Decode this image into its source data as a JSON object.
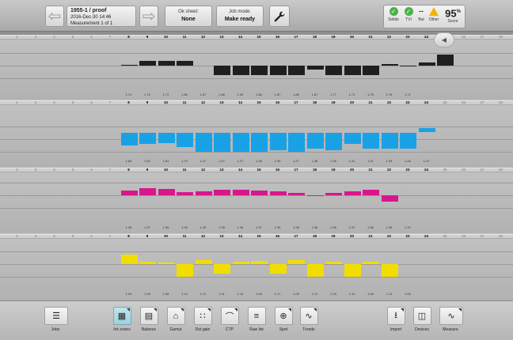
{
  "header": {
    "job_title": "1955-1 / proof",
    "job_date": "2016-Dec-30 14:46",
    "job_measurement": "Measurement 1 of 1",
    "ok_sheet_label": "Ok sheet:",
    "ok_sheet_value": "None",
    "job_mode_label": "Job mode:",
    "job_mode_value": "Make ready",
    "back_icon": "arrow-left-icon",
    "forward_icon": "arrow-right-icon",
    "settings_icon": "wrench-icon"
  },
  "status": {
    "solids_label": "Solids",
    "tvi_label": "TVI",
    "bal_label": "Bal",
    "bal_value": "--",
    "other_label": "Other",
    "score_label": "Score",
    "score_value": "95",
    "score_unit": "%",
    "colors": {
      "ok": "#4ab04a",
      "warning": "#f2b300"
    }
  },
  "zones": {
    "all": [
      "1",
      "2",
      "3",
      "4",
      "5",
      "6",
      "7",
      "8",
      "9",
      "10",
      "11",
      "12",
      "13",
      "14",
      "15",
      "16",
      "17",
      "18",
      "19",
      "20",
      "21",
      "22",
      "23",
      "24",
      "25",
      "26",
      "27",
      "28"
    ],
    "first_active": 8,
    "last_active": 24
  },
  "strips": [
    {
      "name": "black",
      "color": "#1f1f1f",
      "values": [
        "1.70",
        "1.72",
        "1.72",
        "1.86",
        "1.87",
        "1.86",
        "1.90",
        "1.86",
        "1.87",
        "1.86",
        "1.87",
        "1.77",
        "1.71",
        "1.75",
        "1.78",
        "1.71"
      ]
    },
    {
      "name": "cyan",
      "color": "#19a1e6",
      "values": [
        "1.80",
        "1.82",
        "1.81",
        "1.79",
        "1.27",
        "1.27",
        "1.27",
        "1.26",
        "1.90",
        "1.27",
        "1.38",
        "1.26",
        "1.91",
        "1.31",
        "1.39",
        "1.26",
        "1.47"
      ]
    },
    {
      "name": "magenta",
      "color": "#d8178a",
      "values": [
        "1.35",
        "1.37",
        "1.36",
        "1.36",
        "1.39",
        "1.38",
        "1.36",
        "1.37",
        "1.35",
        "1.38",
        "1.36",
        "1.36",
        "1.37",
        "1.38",
        "1.36",
        "1.37"
      ]
    },
    {
      "name": "yellow",
      "color": "#f2dd00",
      "values": [
        "1.00",
        "1.09",
        "1.08",
        "1.14",
        "1.11",
        "1.11",
        "1.14",
        "1.08",
        "1.17",
        "1.05",
        "1.11",
        "1.15",
        "1.11",
        "1.08",
        "1.11",
        "1.02"
      ]
    }
  ],
  "toolbar": {
    "jobs": "Jobs",
    "ink_zones": "Ink zones",
    "balance": "Balance",
    "gamut": "Gamut",
    "dot_gain": "Dot gain",
    "ctp": "CTP",
    "raw_list": "Raw list",
    "spot": "Spot",
    "trends": "Trends",
    "import": "Import",
    "devices": "Devices",
    "measure": "Measure"
  }
}
